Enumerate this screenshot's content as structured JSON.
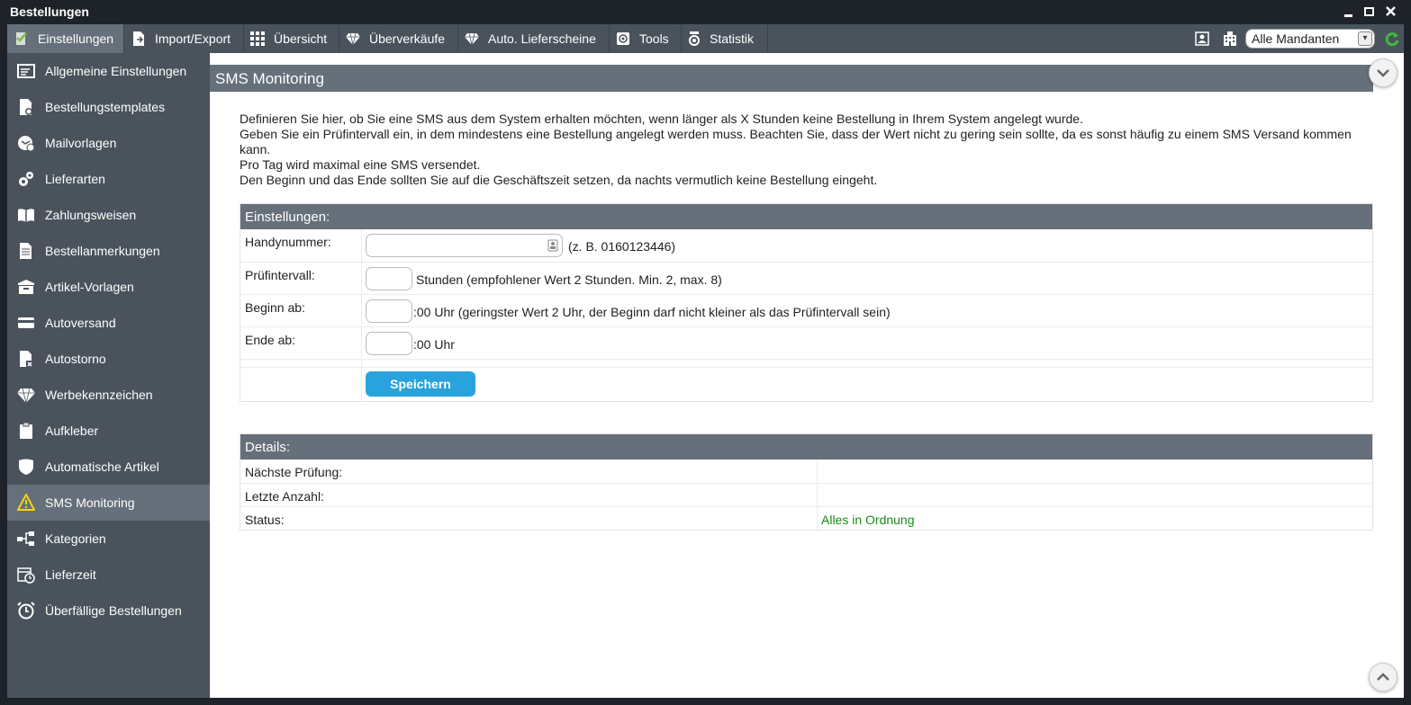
{
  "window": {
    "title": "Bestellungen",
    "minimize": "▁",
    "maximize": "□",
    "close": "✕"
  },
  "toolbar": {
    "items": [
      {
        "label": "Einstellungen",
        "icon": "checklist-icon",
        "active": true
      },
      {
        "label": "Import/Export",
        "icon": "document-arrow-icon"
      },
      {
        "label": "Übersicht",
        "icon": "grid-icon"
      },
      {
        "label": "Überverkäufe",
        "icon": "diamond-icon"
      },
      {
        "label": "Auto. Lieferscheine",
        "icon": "diamond-icon"
      },
      {
        "label": "Tools",
        "icon": "tools-icon"
      },
      {
        "label": "Statistik",
        "icon": "statistics-icon"
      }
    ],
    "mandant_select": "Alle Mandanten"
  },
  "sidebar": {
    "items": [
      {
        "label": "Allgemeine Einstellungen",
        "icon": "settings-list-icon"
      },
      {
        "label": "Bestellungstemplates",
        "icon": "document-settings-icon"
      },
      {
        "label": "Mailvorlagen",
        "icon": "mail-template-icon"
      },
      {
        "label": "Lieferarten",
        "icon": "gears-icon"
      },
      {
        "label": "Zahlungsweisen",
        "icon": "book-icon"
      },
      {
        "label": "Bestellanmerkungen",
        "icon": "document-icon"
      },
      {
        "label": "Artikel-Vorlagen",
        "icon": "box-icon"
      },
      {
        "label": "Autoversand",
        "icon": "card-icon"
      },
      {
        "label": "Autostorno",
        "icon": "document-cancel-icon"
      },
      {
        "label": "Werbekennzeichen",
        "icon": "diamond-icon"
      },
      {
        "label": "Aufkleber",
        "icon": "clipboard-icon"
      },
      {
        "label": "Automatische Artikel",
        "icon": "shield-icon"
      },
      {
        "label": "SMS Monitoring",
        "icon": "warning-icon",
        "active": true
      },
      {
        "label": "Kategorien",
        "icon": "tree-icon"
      },
      {
        "label": "Lieferzeit",
        "icon": "calendar-clock-icon"
      },
      {
        "label": "Überfällige Bestellungen",
        "icon": "alarm-clock-icon"
      }
    ]
  },
  "main": {
    "title": "SMS Monitoring",
    "intro": [
      "Definieren Sie hier, ob Sie eine SMS aus dem System erhalten möchten, wenn länger als X Stunden keine Bestellung in Ihrem System angelegt wurde.",
      "Geben Sie ein Prüfintervall ein, in dem mindestens eine Bestellung angelegt werden muss. Beachten Sie, dass der Wert nicht zu gering sein sollte, da es sonst häufig zu einem SMS Versand kommen kann.",
      "Pro Tag wird maximal eine SMS versendet.",
      "Den Beginn und das Ende sollten Sie auf die Geschäftszeit setzen, da nachts vermutlich keine Bestellung eingeht."
    ],
    "settings": {
      "heading": "Einstellungen:",
      "phone": {
        "label": "Handynummer:",
        "value": "",
        "hint": "(z. B. 0160123446)"
      },
      "interval": {
        "label": "Prüfintervall:",
        "value": "",
        "hint": "Stunden (empfohlener Wert 2 Stunden. Min. 2, max. 8)"
      },
      "begin": {
        "label": "Beginn ab:",
        "value": "",
        "hint": ":00 Uhr (geringster Wert 2 Uhr, der Beginn darf nicht kleiner als das Prüfintervall sein)"
      },
      "end": {
        "label": "Ende ab:",
        "value": "",
        "hint": ":00 Uhr"
      },
      "save_label": "Speichern"
    },
    "details": {
      "heading": "Details:",
      "rows": [
        {
          "label": "Nächste Prüfung:",
          "value": ""
        },
        {
          "label": "Letzte Anzahl:",
          "value": ""
        },
        {
          "label": "Status:",
          "value": "Alles in Ordnung",
          "color": "#1a8a1a"
        }
      ]
    }
  }
}
